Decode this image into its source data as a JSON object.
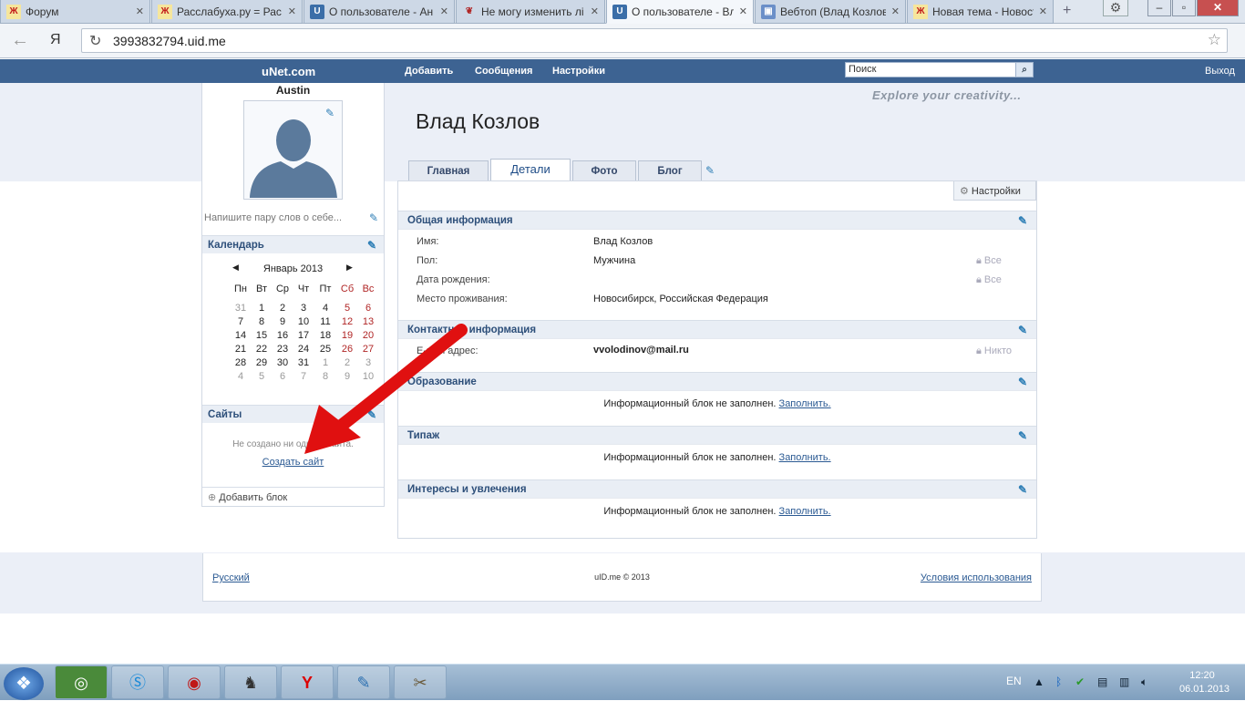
{
  "browser": {
    "tabs": [
      {
        "title": "Форум",
        "icon": "x-favicon"
      },
      {
        "title": "Расслабуха.ру = Рас",
        "icon": "x-favicon"
      },
      {
        "title": "О пользователе - Ан",
        "icon": "u-favicon"
      },
      {
        "title": "Не могу изменить лі",
        "icon": "redwing-favicon"
      },
      {
        "title": "О пользователе - Вл",
        "icon": "u-favicon",
        "active": true
      },
      {
        "title": "Вебтоп (Влад Козлов",
        "icon": "webtop-favicon"
      },
      {
        "title": "Новая тема - Новост",
        "icon": "x-favicon"
      }
    ],
    "close_glyph": "✕",
    "new_tab_glyph": "+",
    "back_glyph": "←",
    "yandex_glyph": "Я",
    "reload_glyph": "↻",
    "star_glyph": "☆",
    "url": "3993832794.uid.me"
  },
  "site": {
    "brand": "uNet.com",
    "nav": [
      "Добавить",
      "Сообщения",
      "Настройки"
    ],
    "search_placeholder": "Поиск",
    "logout": "Выход",
    "tagline": "Explore your creativity...",
    "accent": "#3d6392"
  },
  "left": {
    "username": "Austin",
    "status_placeholder": "Напишите пару слов о себе...",
    "calendar_title": "Календарь",
    "calendar_month": "Январь 2013",
    "weekdays": [
      "Пн",
      "Вт",
      "Ср",
      "Чт",
      "Пт",
      "Сб",
      "Вс"
    ],
    "weeks": [
      [
        "31",
        "1",
        "2",
        "3",
        "4",
        "5",
        "6"
      ],
      [
        "7",
        "8",
        "9",
        "10",
        "11",
        "12",
        "13"
      ],
      [
        "14",
        "15",
        "16",
        "17",
        "18",
        "19",
        "20"
      ],
      [
        "21",
        "22",
        "23",
        "24",
        "25",
        "26",
        "27"
      ],
      [
        "28",
        "29",
        "30",
        "31",
        "1",
        "2",
        "3"
      ],
      [
        "4",
        "5",
        "6",
        "7",
        "8",
        "9",
        "10"
      ]
    ],
    "sites_title": "Сайты",
    "sites_empty": "Не создано ни одного сайта.",
    "create_site": "Создать сайт",
    "add_block": "Добавить блок"
  },
  "profile": {
    "name": "Влад Козлов",
    "tabs": [
      "Главная",
      "Детали",
      "Фото",
      "Блог"
    ],
    "active_tab": "Детали",
    "settings": "Настройки",
    "sections": {
      "general": {
        "title": "Общая информация",
        "rows": [
          {
            "label": "Имя:",
            "value": "Влад Козлов",
            "privacy": ""
          },
          {
            "label": "Пол:",
            "value": "Мужчина",
            "privacy": "Все"
          },
          {
            "label": "Дата рождения:",
            "value": "",
            "privacy": "Все"
          },
          {
            "label": "Место проживания:",
            "value": "Новосибирск, Российская Федерация",
            "privacy": ""
          }
        ]
      },
      "contact": {
        "title": "Контактная информация",
        "rows": [
          {
            "label": "E-mail адрес:",
            "value": "vvolodinov@mail.ru",
            "privacy": "Никто"
          }
        ]
      },
      "education": {
        "title": "Образование"
      },
      "type": {
        "title": "Типаж"
      },
      "interests": {
        "title": "Интересы и увлечения"
      }
    },
    "empty_text": "Информационный блок не заполнен.",
    "fill_link": "Заполнить."
  },
  "footer": {
    "language": "Русский",
    "copyright": "uID.me © 2013",
    "terms": "Условия использования"
  },
  "taskbar": {
    "lang": "EN",
    "time": "12:20",
    "date": "06.01.2013"
  }
}
